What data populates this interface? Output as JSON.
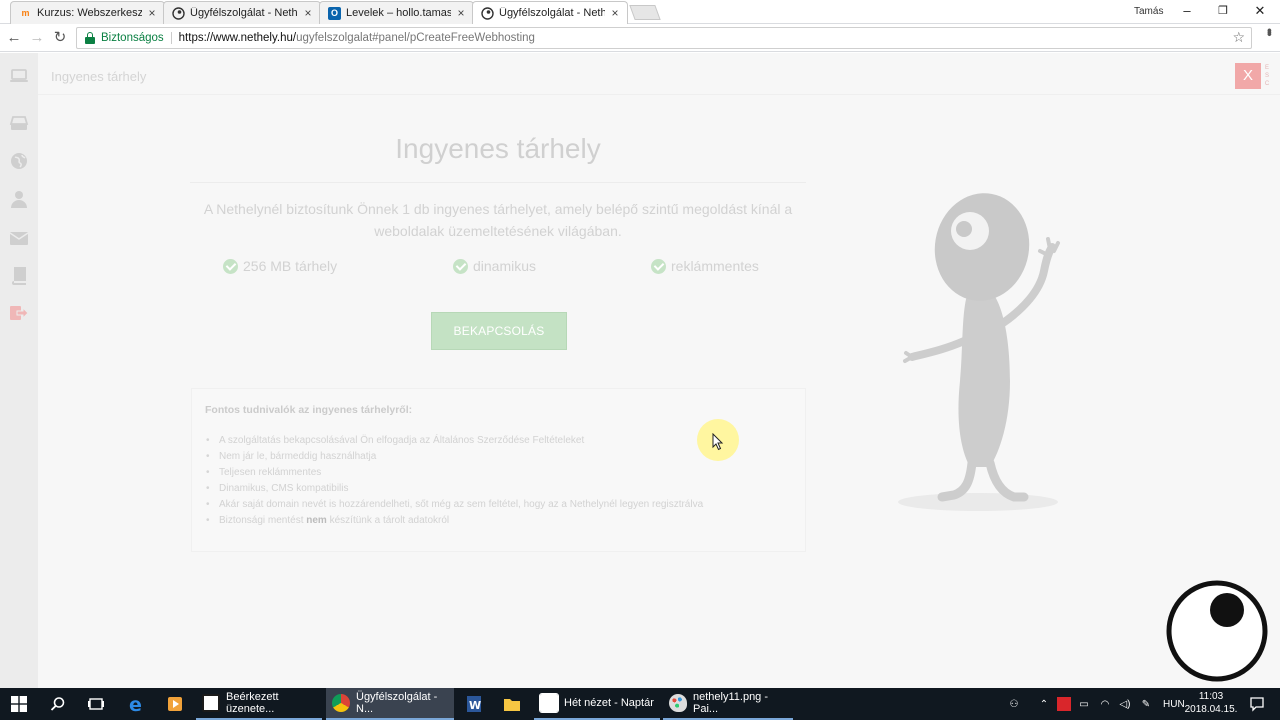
{
  "browser": {
    "tabs": [
      {
        "title": "Kurzus: Webszerkesztés",
        "favicon": "moodle-icon",
        "active": false
      },
      {
        "title": "Ügyfélszolgálat - Netheľ",
        "favicon": "nethely-icon",
        "active": false
      },
      {
        "title": "Levelek – hollo.tamas@b",
        "favicon": "outlook-icon",
        "active": false
      },
      {
        "title": "Ügyfélszolgálat - Netheľ",
        "favicon": "nethely-icon",
        "active": true
      }
    ],
    "profile_name": "Tamás",
    "window_controls": {
      "minimize": "–",
      "restore": "❐",
      "close": "✕"
    },
    "secure_label": "Biztonságos",
    "url_host": "https://www.nethely.hu/",
    "url_path": "ugyfelszolgalat#panel/pCreateFreeWebhosting"
  },
  "panel": {
    "header_title": "Ingyenes tárhely",
    "close_label": "X",
    "esc_letters": "ESC"
  },
  "content": {
    "title": "Ingyenes tárhely",
    "lead": "A Nethelynél biztosítunk Önnek 1 db ingyenes tárhelyet, amely belépő szintű megoldást kínál a weboldalak üzemeltetésének világában.",
    "features": [
      "256 MB tárhely",
      "dinamikus",
      "reklámmentes"
    ],
    "enable_button": "BEKAPCSOLÁS",
    "info": {
      "title": "Fontos tudnivalók az ingyenes tárhelyről:",
      "items": [
        "A szolgáltatás bekapcsolásával Ön elfogadja az Általános Szerződése Feltételeket",
        "Nem jár le, bármeddig használhatja",
        "Teljesen reklámmentes",
        "Dinamikus, CMS kompatibilis",
        "Akár saját domain nevét is hozzárendelheti, sőt még az sem feltétel, hogy az a Nethelynél legyen regisztrálva"
      ],
      "last_item_prefix": "Biztonsági mentést ",
      "last_item_bold": "nem",
      "last_item_suffix": " készítünk a tárolt adatokról"
    }
  },
  "taskbar": {
    "apps": [
      {
        "label": "Beérkezett üzenete...",
        "icon": "mail-icon",
        "active": false
      },
      {
        "label": "Ügyfélszolgálat - N...",
        "icon": "chrome-icon",
        "active": true
      },
      {
        "label": "Hét nézet - Naptár",
        "icon": "calendar-icon",
        "active": false
      },
      {
        "label": "nethely11.png - Pai...",
        "icon": "paint-icon",
        "active": false
      }
    ],
    "language": "HUN",
    "time": "11:03",
    "date": "2018.04.15."
  },
  "colors": {
    "accent_green": "#c4e2c4",
    "close_red": "#f1a8a8",
    "secure_green": "#0b8043",
    "taskbar_bg": "#101820"
  }
}
